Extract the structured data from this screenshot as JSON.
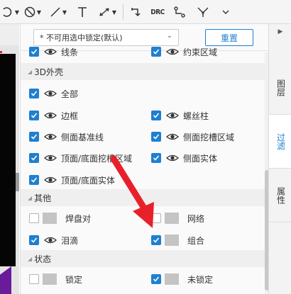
{
  "toolbar": {
    "tools": [
      {
        "icon": "ellipse-tool-icon",
        "has_dropdown": true
      },
      {
        "icon": "prohibited-region-icon",
        "has_dropdown": true
      },
      {
        "icon": "line-tool-icon",
        "has_dropdown": true
      },
      {
        "icon": "text-tool-icon",
        "has_dropdown": false
      },
      {
        "icon": "dimension-tool-icon",
        "has_dropdown": true
      },
      {
        "icon": "rotate-tool-icon",
        "has_dropdown": false
      },
      {
        "icon": "drc-icon",
        "label": "DRC"
      },
      {
        "icon": "route-icon",
        "has_dropdown": false
      },
      {
        "icon": "fanout-icon",
        "has_dropdown": false
      },
      {
        "icon": "chevron-down-icon",
        "has_dropdown": false
      }
    ]
  },
  "filter": {
    "select_value": "* 不可用选中锁定(默认)",
    "reset_label": "重置"
  },
  "top_partial_row": {
    "left_label": "线条",
    "right_label": "约束区域"
  },
  "sections": {
    "shell3d": {
      "title": "3D外壳",
      "items": [
        {
          "label": "全部",
          "checked": true
        },
        {
          "label": "边框",
          "checked": true
        },
        {
          "label": "螺丝柱",
          "checked": true
        },
        {
          "label": "侧面基准线",
          "checked": true
        },
        {
          "label": "侧面挖槽区域",
          "checked": true
        },
        {
          "label": "顶面/底面挖槽区域",
          "checked": true
        },
        {
          "label": "侧面实体",
          "checked": true
        },
        {
          "label": "顶面/底面实体",
          "checked": true
        }
      ]
    },
    "other": {
      "title": "其他",
      "items": [
        {
          "label": "焊盘对",
          "checked": false
        },
        {
          "label": "网络",
          "checked": false
        },
        {
          "label": "泪滴",
          "checked": true
        },
        {
          "label": "组合",
          "checked": true
        }
      ]
    },
    "status": {
      "title": "状态",
      "items": [
        {
          "label": "锁定",
          "checked": false
        },
        {
          "label": "未锁定",
          "checked": true
        }
      ]
    }
  },
  "tabs": [
    {
      "label": "图层",
      "active": false
    },
    {
      "label": "过滤",
      "active": true
    },
    {
      "label": "属性",
      "active": false
    }
  ],
  "colors": {
    "accent": "#1f7fd0",
    "annotation_arrow": "#e8202a",
    "canvas": "#050505"
  }
}
